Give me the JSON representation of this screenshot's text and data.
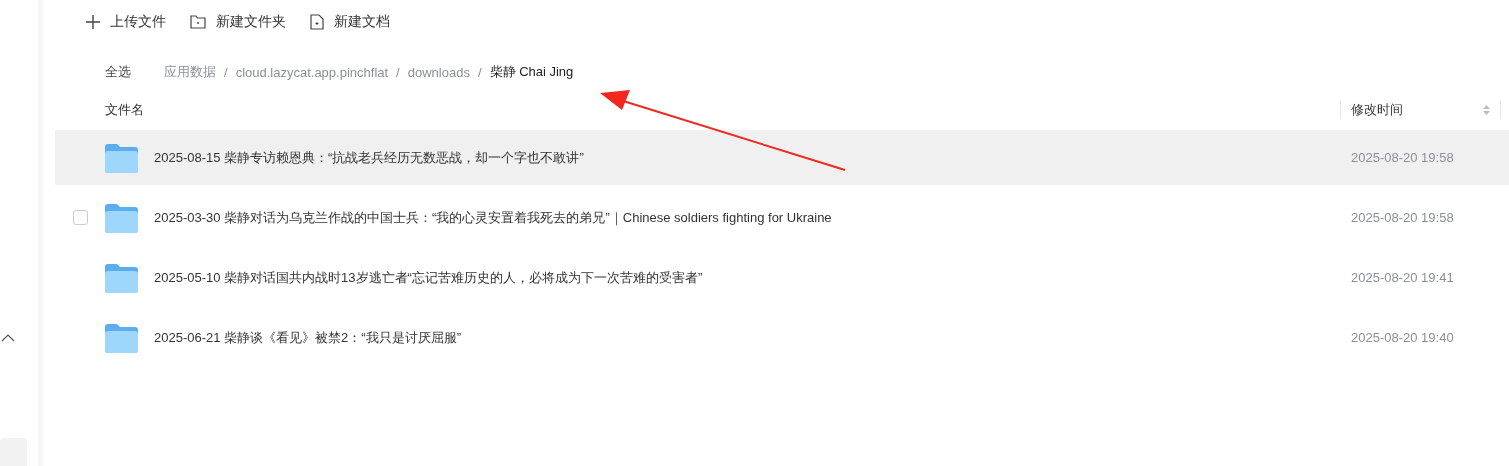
{
  "toolbar": [
    {
      "kind": "upload",
      "label": "上传文件"
    },
    {
      "kind": "folder",
      "label": "新建文件夹"
    },
    {
      "kind": "document",
      "label": "新建文档"
    }
  ],
  "select_all": "全选",
  "breadcrumb": [
    {
      "label": "应用数据",
      "current": false
    },
    {
      "label": "cloud.lazycat.app.pinchflat",
      "current": false
    },
    {
      "label": "downloads",
      "current": false
    },
    {
      "label": "柴静 Chai Jing",
      "current": true
    }
  ],
  "breadcrumb_separator": "/",
  "table": {
    "columns": [
      "文件名",
      "修改时间"
    ],
    "rows": [
      {
        "name": "2025-08-15 柴静专访赖恩典：“抗战老兵经历无数恶战，却一个字也不敢讲”",
        "modified": "2025-08-20 19:58",
        "highlighted": true
      },
      {
        "name": "2025-03-30 柴静对话为乌克兰作战的中国士兵：“我的心灵安置着我死去的弟兄”｜Chinese soldiers fighting for Ukraine",
        "modified": "2025-08-20 19:58",
        "highlighted": false,
        "checkbox": {
          "checked": false
        }
      },
      {
        "name": "2025-05-10 柴静对话国共内战时13岁逃亡者“忘记苦难历史的人，必将成为下一次苦难的受害者”",
        "modified": "2025-08-20 19:41",
        "highlighted": false
      },
      {
        "name": "2025-06-21 柴静谈《看见》被禁2：“我只是讨厌屈服”",
        "modified": "2025-08-20 19:40",
        "highlighted": false
      }
    ]
  }
}
